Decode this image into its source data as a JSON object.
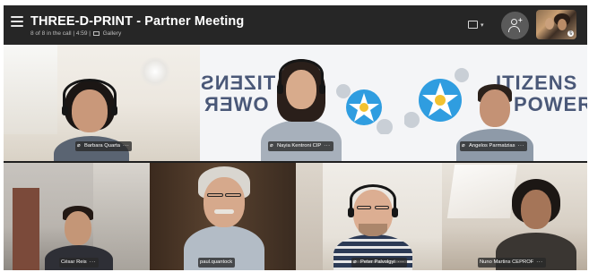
{
  "header": {
    "title": "THREE-D-PRINT - Partner Meeting",
    "call_info": "8 of 8 in the call | 4:59 |",
    "view_label": "Gallery"
  },
  "banner": {
    "word_top_left": "TIZENS",
    "word_bottom_left": "OWER",
    "word_top_right": "ITIZENS",
    "word_bottom_right": "POWER"
  },
  "participants": [
    {
      "name": "Barbara Quarta",
      "more": "···"
    },
    {
      "name": "Nayia Kentroni CIP",
      "more": "···"
    },
    {
      "name": "Angelos Parmatzias",
      "more": "···"
    },
    {
      "name": "César Reis",
      "more": "···"
    },
    {
      "name": "paul.quantock",
      "more": "···"
    },
    {
      "name": "Peter Palvolgyi",
      "more": "···"
    },
    {
      "name": "Nuno Martins CEPROF",
      "more": "···"
    }
  ],
  "colors": {
    "header_bg": "#262626",
    "banner_text": "#4a5878",
    "flower_blue": "#2f9de0",
    "flower_white": "#ffffff",
    "flower_center": "#f2c230"
  },
  "icons": [
    "menu-icon",
    "gallery-icon",
    "layout-icon",
    "add-person-icon",
    "mic-off-icon",
    "more-options-icon"
  ]
}
